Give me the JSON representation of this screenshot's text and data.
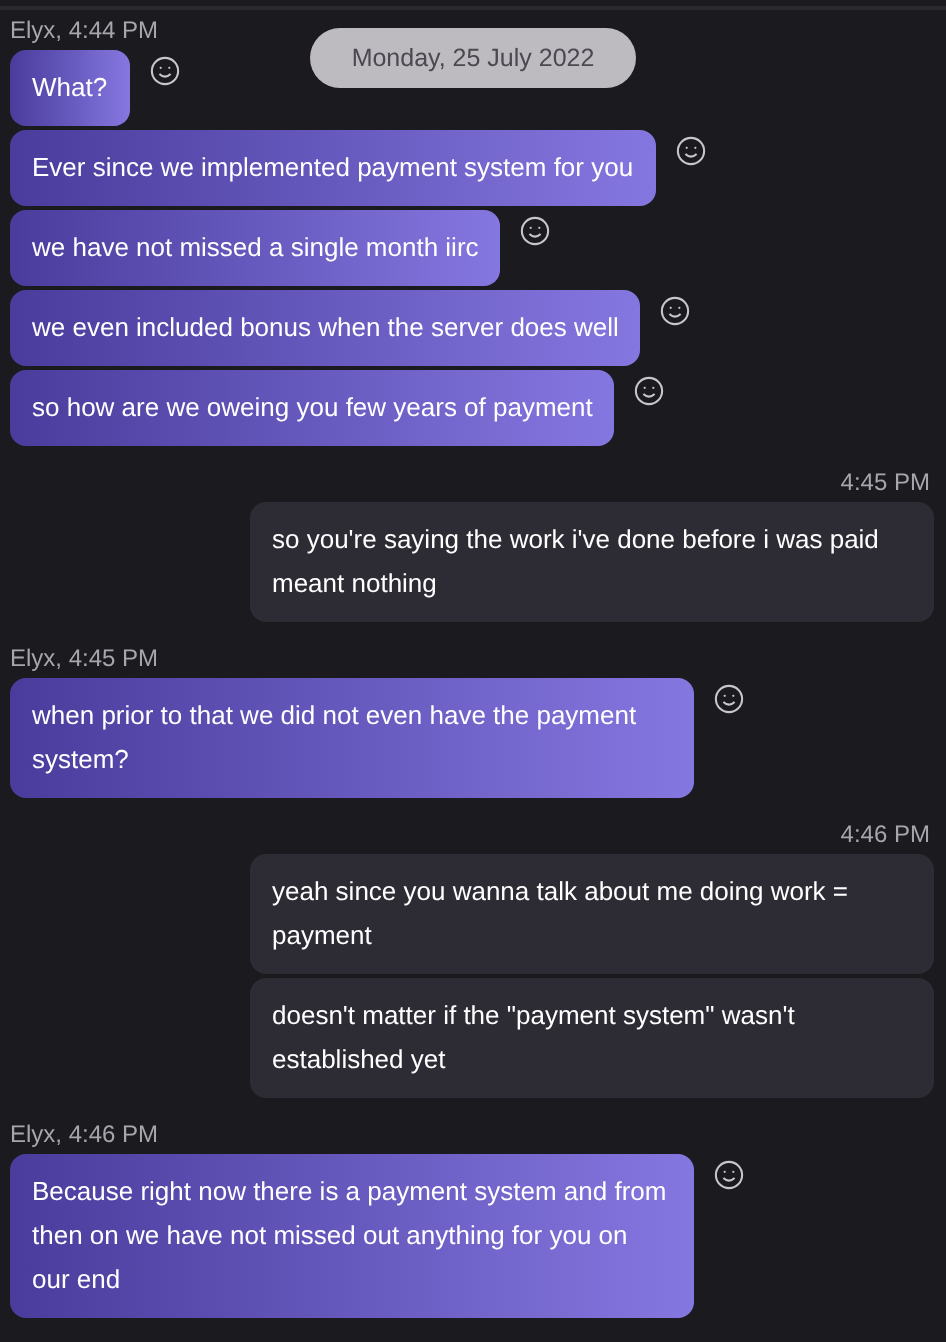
{
  "date_divider": "Monday, 25 July 2022",
  "groups": [
    {
      "kind": "incoming",
      "header": "Elyx, 4:44 PM",
      "messages": [
        "What?",
        "Ever since we implemented payment system for you",
        "we have not missed a single month iirc",
        "we even included bonus when the server does well",
        "so how are we oweing you few years of payment"
      ]
    },
    {
      "kind": "outgoing",
      "header": "4:45 PM",
      "messages": [
        "so you're saying the work i've done before i was paid meant nothing"
      ]
    },
    {
      "kind": "incoming",
      "header": "Elyx, 4:45 PM",
      "messages": [
        "when prior to that we did not even have the payment system?"
      ]
    },
    {
      "kind": "outgoing",
      "header": "4:46 PM",
      "messages": [
        "yeah since you wanna talk about me doing work = payment",
        "doesn't matter if the \"payment system\" wasn't established yet"
      ]
    },
    {
      "kind": "incoming",
      "header": "Elyx, 4:46 PM",
      "messages": [
        "Because right now there is a payment system and from then on we have not missed out anything for you on our end"
      ]
    }
  ]
}
